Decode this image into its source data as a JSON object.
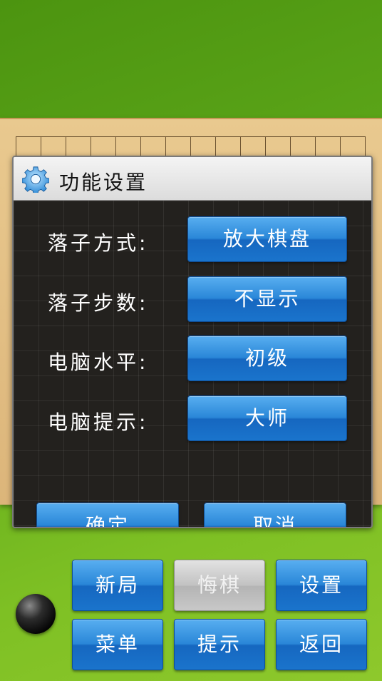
{
  "dialog": {
    "title": "功能设置",
    "rows": [
      {
        "label": "落子方式:",
        "value": "放大棋盘"
      },
      {
        "label": "落子步数:",
        "value": "不显示"
      },
      {
        "label": "电脑水平:",
        "value": "初级"
      },
      {
        "label": "电脑提示:",
        "value": "大师"
      }
    ],
    "confirm_label": "确定",
    "cancel_label": "取消"
  },
  "toolbar": {
    "new_game": "新局",
    "undo": "悔棋",
    "settings": "设置",
    "menu": "菜单",
    "hint": "提示",
    "back": "返回"
  },
  "colors": {
    "button_blue": "#2a87d8",
    "disabled_gray": "#c2c2c2",
    "background_green": "#5ea81a",
    "board_wood": "#dcb57a"
  },
  "icons": {
    "dialog_icon": "gear-icon",
    "player_stone": "black-stone-icon"
  }
}
